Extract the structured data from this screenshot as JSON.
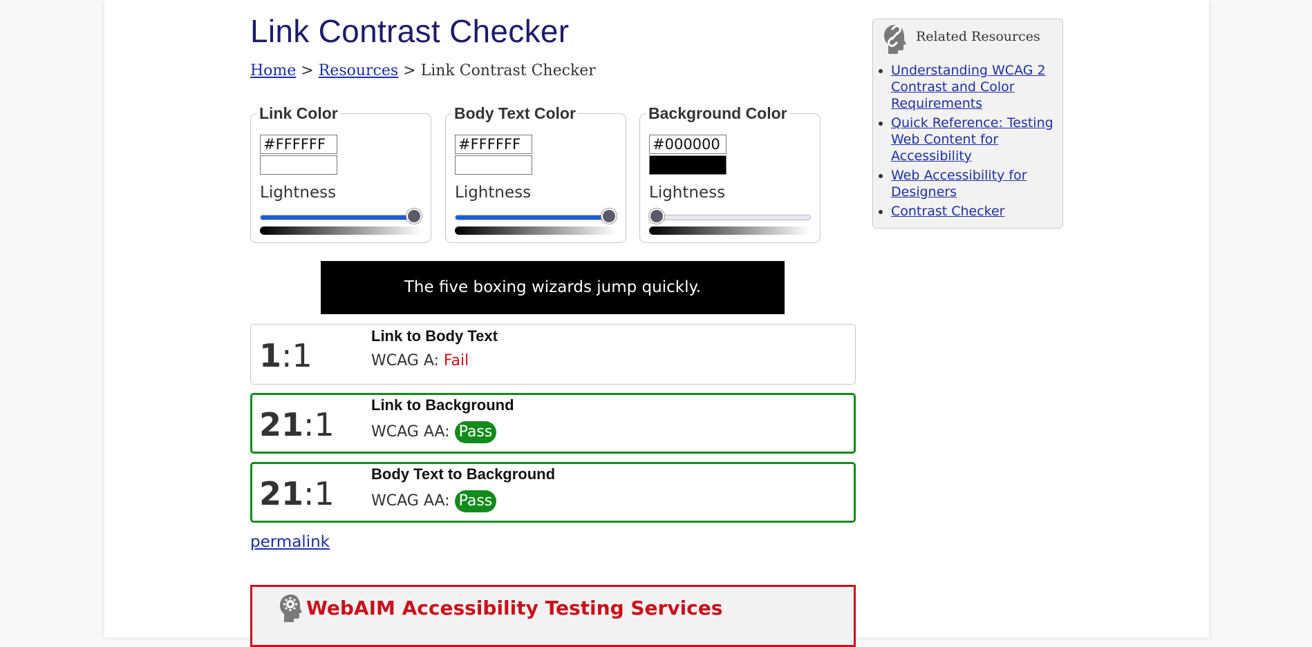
{
  "title": "Link Contrast Checker",
  "breadcrumb": {
    "home": "Home",
    "sep1": " > ",
    "resources": "Resources",
    "sep2": " > ",
    "current": "Link Contrast Checker"
  },
  "pickers": [
    {
      "legend": "Link Color",
      "hex": "#FFFFFF",
      "swatch": "#FFFFFF",
      "lightness_label": "Lightness",
      "lightness": 100
    },
    {
      "legend": "Body Text Color",
      "hex": "#FFFFFF",
      "swatch": "#FFFFFF",
      "lightness_label": "Lightness",
      "lightness": 100
    },
    {
      "legend": "Background Color",
      "hex": "#000000",
      "swatch": "#000000",
      "lightness_label": "Lightness",
      "lightness": 0
    }
  ],
  "sample_text": "The five boxing wizards jump quickly.",
  "results": [
    {
      "ratio_main": "1",
      "ratio_rest": ":1",
      "title": "Link to Body Text",
      "wcag_label": "WCAG A: ",
      "status": "Fail"
    },
    {
      "ratio_main": "21",
      "ratio_rest": ":1",
      "title": "Link to Background",
      "wcag_label": "WCAG AA: ",
      "status": "Pass"
    },
    {
      "ratio_main": "21",
      "ratio_rest": ":1",
      "title": "Body Text to Background",
      "wcag_label": "WCAG AA: ",
      "status": "Pass"
    }
  ],
  "permalink": "permalink",
  "services": {
    "title": "WebAIM Accessibility Testing Services",
    "icon": "gear-head-icon"
  },
  "sidebar": {
    "title": "Related Resources",
    "icon": "link-head-icon",
    "links": [
      "Understanding WCAG 2 Contrast and Color Requirements",
      "Quick Reference: Testing Web Content for Accessibility",
      "Web Accessibility for Designers",
      "Contrast Checker"
    ]
  },
  "colors": {
    "title": "#1c1b6b",
    "link": "#1b2fa3",
    "pass": "#138a1c",
    "fail": "#c8101c",
    "slider_fill": "#1a5fd6"
  }
}
